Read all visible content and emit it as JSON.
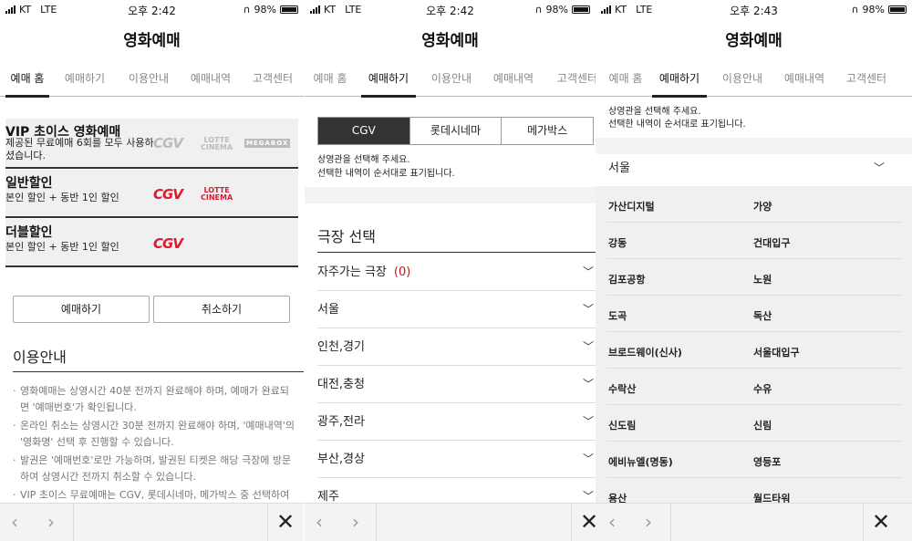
{
  "status": {
    "carrier": "KT",
    "network": "LTE",
    "battery": "98%",
    "times": [
      "오후 2:42",
      "오후 2:42",
      "오후 2:43"
    ]
  },
  "app_title": "영화예매",
  "tabs": [
    "예매 홈",
    "예매하기",
    "이용안내",
    "예매내역",
    "고객센터"
  ],
  "screen1": {
    "cards": [
      {
        "title": "VIP 초이스 영화예매",
        "desc_line1": "제공된 무료예매 6회를 모두 사용하",
        "desc_line2": "셨습니다."
      },
      {
        "title": "일반할인",
        "desc_line1": "본인 할인 + 동반 1인 할인"
      },
      {
        "title": "더블할인",
        "desc_line1": "본인 할인 + 동반 1인 할인"
      }
    ],
    "logos": {
      "cgv": "CGV",
      "lotte_top": "LOTTE",
      "lotte_bottom": "CINEMA",
      "mega": "MEGABOX"
    },
    "book_button": "예매하기",
    "cancel_button": "취소하기",
    "guide_heading": "이용안내",
    "guide_items": [
      "영화예매는 상영시간 40분 전까지 완료해야 하며, 예매가 완료되면 '예매번호'가 확인됩니다.",
      "온라인 취소는 상영시간 30분 전까지 완료해야 하며, '예매내역'의 '영화명' 선택 후 진행할 수 있습니다.",
      "발권은 '예매번호'로만 가능하며, 발권된 티켓은 해당 극장에 방문하여 상영시간 전까지 취소할 수 있습니다.",
      "VIP 초이스 무료예매는 CGV, 롯데시네마, 메가박스 중 선택하여"
    ]
  },
  "screen2": {
    "cinemas": [
      "CGV",
      "롯데시네마",
      "메가박스"
    ],
    "note_line1": "상영관을 선택해 주세요.",
    "note_line2": "선택한 내역이 순서대로 표기됩니다.",
    "section_heading": "극장 선택",
    "favorites_label": "자주가는 극장",
    "favorites_count": "(0)",
    "regions": [
      "서울",
      "인천,경기",
      "대전,충청",
      "광주,전라",
      "부산,경상",
      "제주"
    ]
  },
  "screen3": {
    "note_line1": "상영관을 선택해 주세요.",
    "note_line2": "선택한 내역이 순서대로 표기됩니다.",
    "region": "서울",
    "theaters": [
      [
        "가산디지털",
        "가양"
      ],
      [
        "강동",
        "건대입구"
      ],
      [
        "김포공항",
        "노원"
      ],
      [
        "도곡",
        "독산"
      ],
      [
        "브로드웨이(신사)",
        "서울대입구"
      ],
      [
        "수락산",
        "수유"
      ],
      [
        "신도림",
        "신림"
      ],
      [
        "에비뉴엘(명동)",
        "영등포"
      ],
      [
        "용산",
        "월드타워"
      ]
    ]
  },
  "icons": {
    "back": "chevron-left-icon",
    "forward": "chevron-right-icon",
    "close": "close-icon",
    "expand": "chevron-down-icon"
  },
  "colors": {
    "accent_red": "#e1182e",
    "selected_dark": "#333333",
    "count_red": "#c3151c"
  }
}
